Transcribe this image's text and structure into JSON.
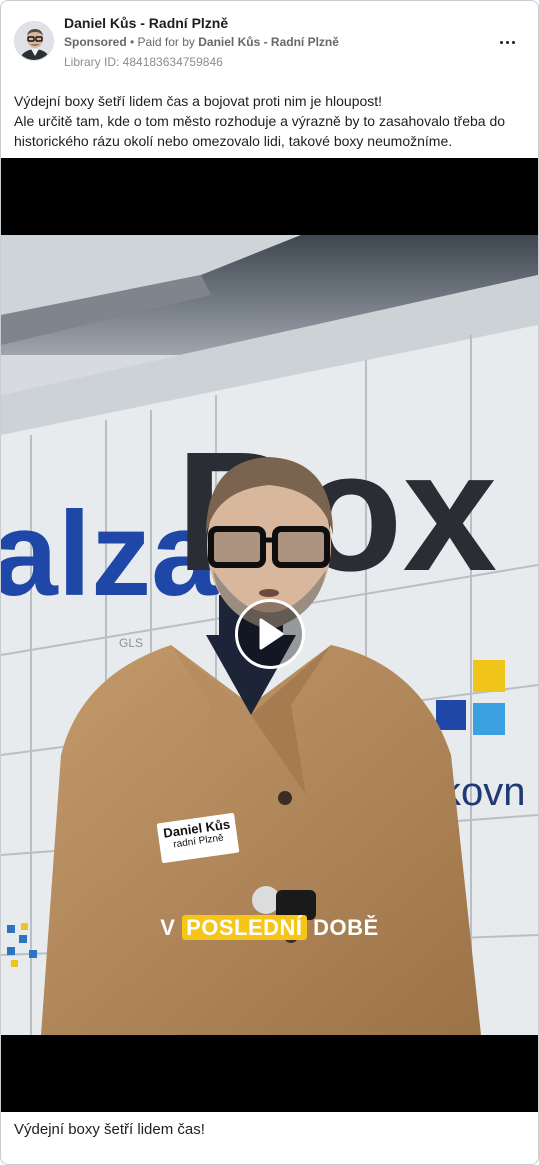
{
  "post": {
    "page_name": "Daniel Kůs - Radní Plzně",
    "sponsored_label": "Sponsored",
    "paid_for_prefix": " • Paid for by ",
    "paid_for_by": "Daniel Kůs - Radní Plzně",
    "library_id": "Library ID: 484183634759846",
    "body_lines": [
      "Výdejní boxy šetří lidem čas a bojovat proti nim je hloupost!",
      "Ale určitě tam, kde o tom město rozhoduje a výrazně by to zasahovalo třeba do historického rázu okolí nebo omezovalo lidi, takové boxy neumožníme."
    ],
    "footer_text": "Výdejní boxy šetří lidem čas!"
  },
  "video": {
    "name_tag_name": "Daniel Kůs",
    "name_tag_role": "radní Plzně",
    "caption_word1": "V ",
    "caption_highlight": "POSLEDNÍ",
    "caption_word2": " DOBĚ",
    "locker_brand_fragment": "alza",
    "locker_brand_fragment2": "Box",
    "locker_side_text": "kovn",
    "locker_small_label": "GLS"
  },
  "icons": {
    "more": "more-dots-icon",
    "play": "play-icon",
    "avatar": "avatar"
  },
  "colors": {
    "caption_highlight": "#f5c518",
    "brand_blue": "#1f47a8",
    "text_primary": "#1c1e21",
    "text_secondary": "#65676b"
  }
}
